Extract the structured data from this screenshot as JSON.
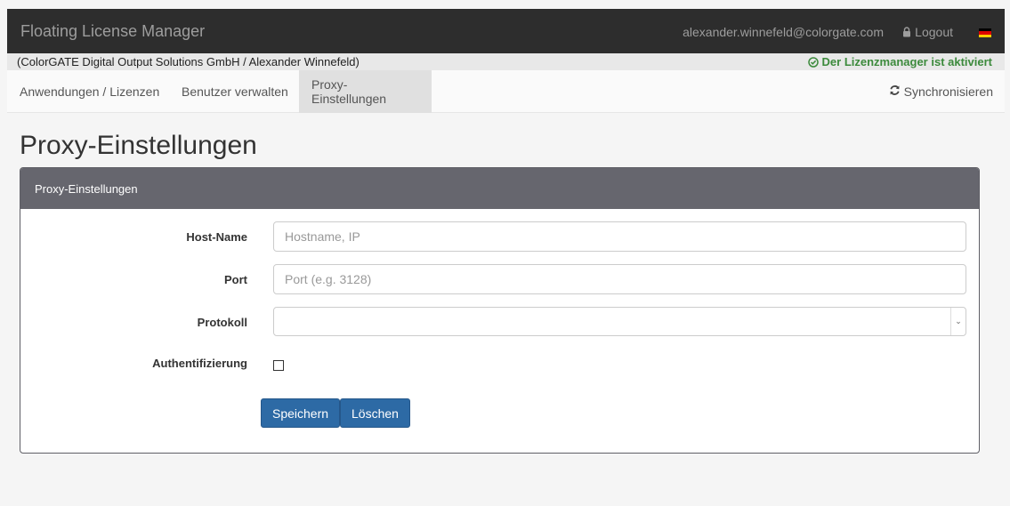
{
  "header": {
    "brand": "Floating License Manager",
    "user_email": "alexander.winnefeld@colorgate.com",
    "logout_label": "Logout",
    "language_flag": "german-flag-icon"
  },
  "subheader": {
    "organization": "(ColorGATE Digital Output Solutions GmbH / Alexander Winnefeld)",
    "status": "Der Lizenzmanager ist aktiviert",
    "status_color": "#3c8a3c"
  },
  "nav": {
    "tabs": [
      {
        "label": "Anwendungen / Lizenzen",
        "active": false
      },
      {
        "label": "Benutzer verwalten",
        "active": false
      },
      {
        "label": "Proxy-Einstellungen",
        "active": true
      }
    ],
    "sync_label": "Synchronisieren"
  },
  "page": {
    "title": "Proxy-Einstellungen"
  },
  "panel": {
    "heading": "Proxy-Einstellungen",
    "fields": {
      "host": {
        "label": "Host-Name",
        "value": "",
        "placeholder": "Hostname, IP"
      },
      "port": {
        "label": "Port",
        "value": "",
        "placeholder": "Port (e.g. 3128)"
      },
      "protocol": {
        "label": "Protokoll",
        "selected": ""
      },
      "auth": {
        "label": "Authentifizierung",
        "checked": false
      }
    },
    "buttons": {
      "save": "Speichern",
      "delete": "Löschen"
    }
  },
  "colors": {
    "topbar": "#2d2d2d",
    "panel_heading": "#66666e",
    "primary_button": "#2d6aa5"
  }
}
